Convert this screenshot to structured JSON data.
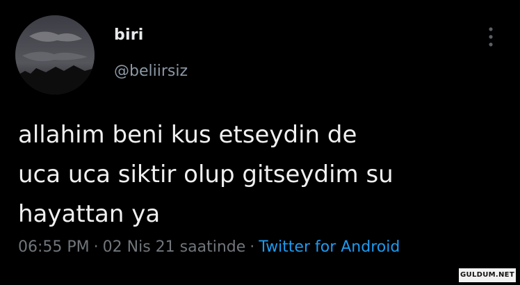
{
  "author": {
    "display_name": "biri",
    "handle": "@beliirsiz",
    "avatar_icon": "profile-avatar"
  },
  "tweet": {
    "text": "allahim beni kus etseydin de\nuca uca siktir olup gitseydim su\nhayattan ya"
  },
  "meta": {
    "time": "06:55 PM",
    "date": "02 Nis 21 saatinde",
    "separator": "·",
    "source": "Twitter for Android"
  },
  "menu": {
    "icon": "more-vertical-icon"
  },
  "watermark": "GULDUM.NET",
  "colors": {
    "background": "#000000",
    "text": "#e7e9ea",
    "secondary": "#71767b",
    "link": "#1d9bf0"
  }
}
